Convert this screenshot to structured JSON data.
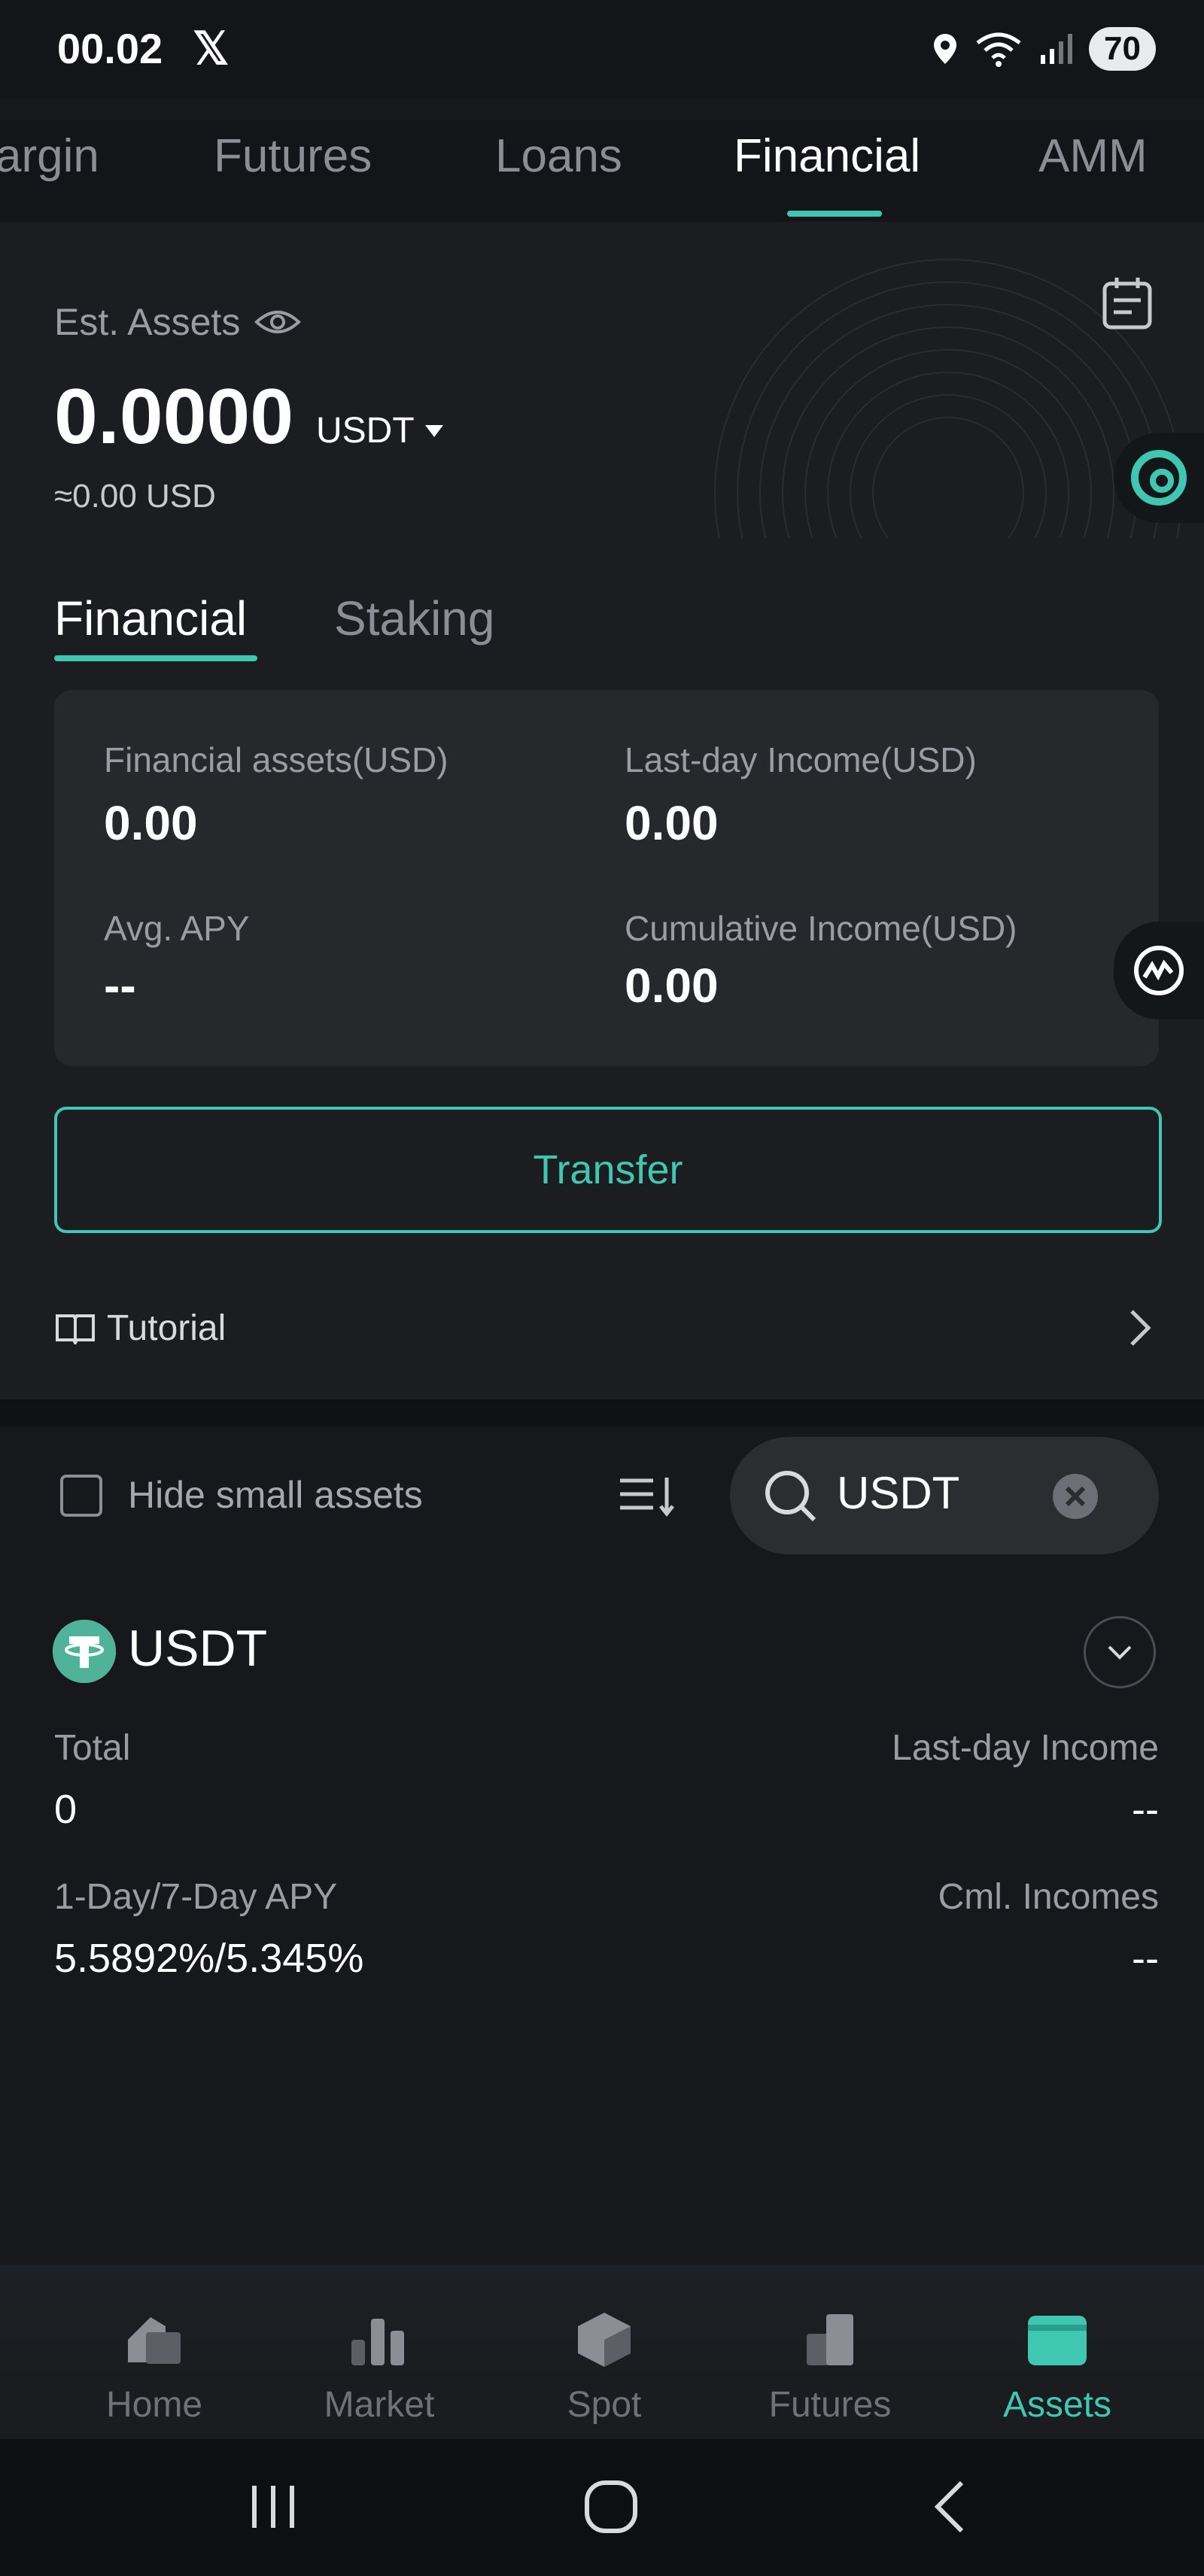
{
  "status_bar": {
    "time": "00.02",
    "app_icon": "x-logo",
    "battery": "70",
    "icons": [
      "location-icon",
      "wifi-icon",
      "signal-icon"
    ]
  },
  "top_tabs": {
    "items": [
      "argin",
      "Futures",
      "Loans",
      "Financial",
      "AMM"
    ],
    "active": "Financial"
  },
  "assets": {
    "est_label": "Est. Assets",
    "amount": "0.0000",
    "unit": "USDT",
    "approx": "≈0.00 USD"
  },
  "sub_tabs": {
    "financial": "Financial",
    "staking": "Staking"
  },
  "summary": {
    "financial_assets_label": "Financial assets(USD)",
    "financial_assets_value": "0.00",
    "last_day_income_label": "Last-day Income(USD)",
    "last_day_income_value": "0.00",
    "avg_apy_label": "Avg. APY",
    "avg_apy_value": "--",
    "cumulative_income_label": "Cumulative Income(USD)",
    "cumulative_income_value": "0.00"
  },
  "transfer_label": "Transfer",
  "tutorial_label": "Tutorial",
  "filter": {
    "hide_small_label": "Hide small assets",
    "search_value": "USDT"
  },
  "coin": {
    "name": "USDT",
    "total_label": "Total",
    "total_value": "0",
    "last_day_label": "Last-day Income",
    "last_day_value": "--",
    "apy_label": "1-Day/7-Day APY",
    "apy_value": "5.5892%/5.345%",
    "cml_label": "Cml. Incomes",
    "cml_value": "--"
  },
  "bottom_nav": {
    "home": "Home",
    "market": "Market",
    "spot": "Spot",
    "futures": "Futures",
    "assets": "Assets",
    "active": "Assets"
  },
  "colors": {
    "accent": "#3fc7b1",
    "background": "#17181b",
    "card": "#26282c"
  }
}
